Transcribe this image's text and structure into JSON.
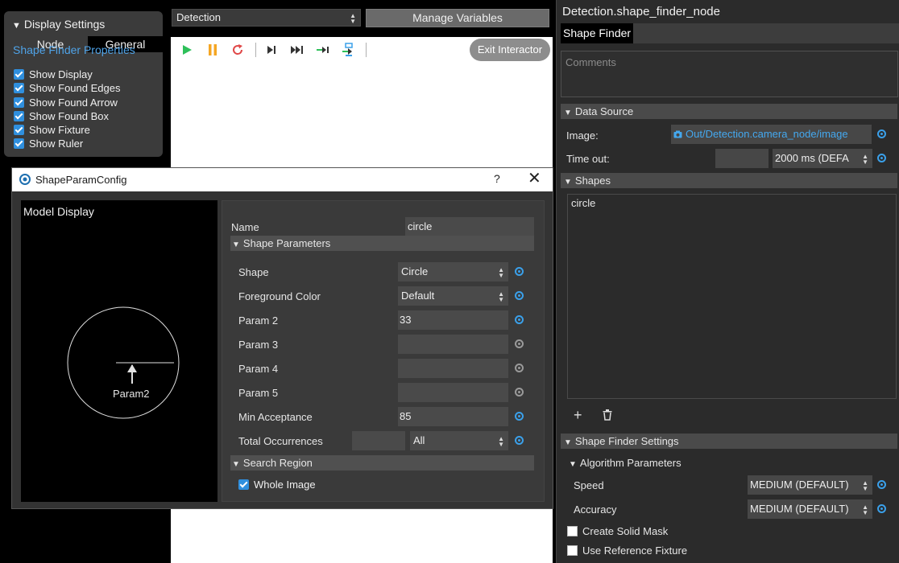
{
  "display_settings": {
    "header": "Display Settings",
    "tabs": [
      "Node",
      "General"
    ],
    "section_title": "Shape Finder Properties",
    "checkboxes": [
      "Show Display",
      "Show Found Edges",
      "Show Found Arrow",
      "Show Found Box",
      "Show Fixture",
      "Show Ruler"
    ]
  },
  "toolbar": {
    "node_select": "Detection",
    "manage_variables": "Manage Variables",
    "exit_interactor": "Exit Interactor",
    "icons": [
      "play-icon",
      "pause-icon",
      "restart-icon",
      "step-icon",
      "fast-forward-icon",
      "step-into-icon",
      "step-out-icon"
    ]
  },
  "dialog": {
    "title": "ShapeParamConfig",
    "help": "?",
    "close": "✕",
    "model_display_label": "Model Display",
    "model_arrow_label": "Param2",
    "name_label": "Name",
    "name_value": "circle",
    "shape_parameters": "Shape Parameters",
    "rows": [
      {
        "label": "Shape",
        "value": "Circle",
        "type": "select"
      },
      {
        "label": "Foreground Color",
        "value": "Default",
        "type": "select"
      },
      {
        "label": "Param 2",
        "value": "33",
        "type": "field"
      },
      {
        "label": "Param 3",
        "value": "",
        "type": "field"
      },
      {
        "label": "Param 4",
        "value": "",
        "type": "field"
      },
      {
        "label": "Param 5",
        "value": "",
        "type": "field"
      },
      {
        "label": "Min Acceptance",
        "value": "85",
        "type": "field"
      }
    ],
    "total_occurrences_label": "Total Occurrences",
    "total_occurrences_value": "All",
    "search_region": "Search Region",
    "whole_image": "Whole Image"
  },
  "right_panel": {
    "node_title": "Detection.shape_finder_node",
    "tab": "Shape Finder",
    "comments_placeholder": "Comments",
    "data_source": "Data Source",
    "image_label": "Image:",
    "image_value": "Out/Detection.camera_node/image",
    "timeout_label": "Time out:",
    "timeout_value": "2000 ms (DEFA",
    "shapes_header": "Shapes",
    "shapes": [
      "circle"
    ],
    "settings_header": "Shape Finder Settings",
    "algorithm_header": "Algorithm Parameters",
    "speed_label": "Speed",
    "speed_value": "MEDIUM (DEFAULT)",
    "accuracy_label": "Accuracy",
    "accuracy_value": "MEDIUM (DEFAULT)",
    "create_solid_mask": "Create Solid Mask",
    "use_reference_fixture": "Use Reference Fixture"
  },
  "colors": {
    "accent_blue": "#3aa0ea",
    "play_green": "#2ec05a",
    "pause_orange": "#f5a623",
    "restart_red": "#e04848"
  }
}
